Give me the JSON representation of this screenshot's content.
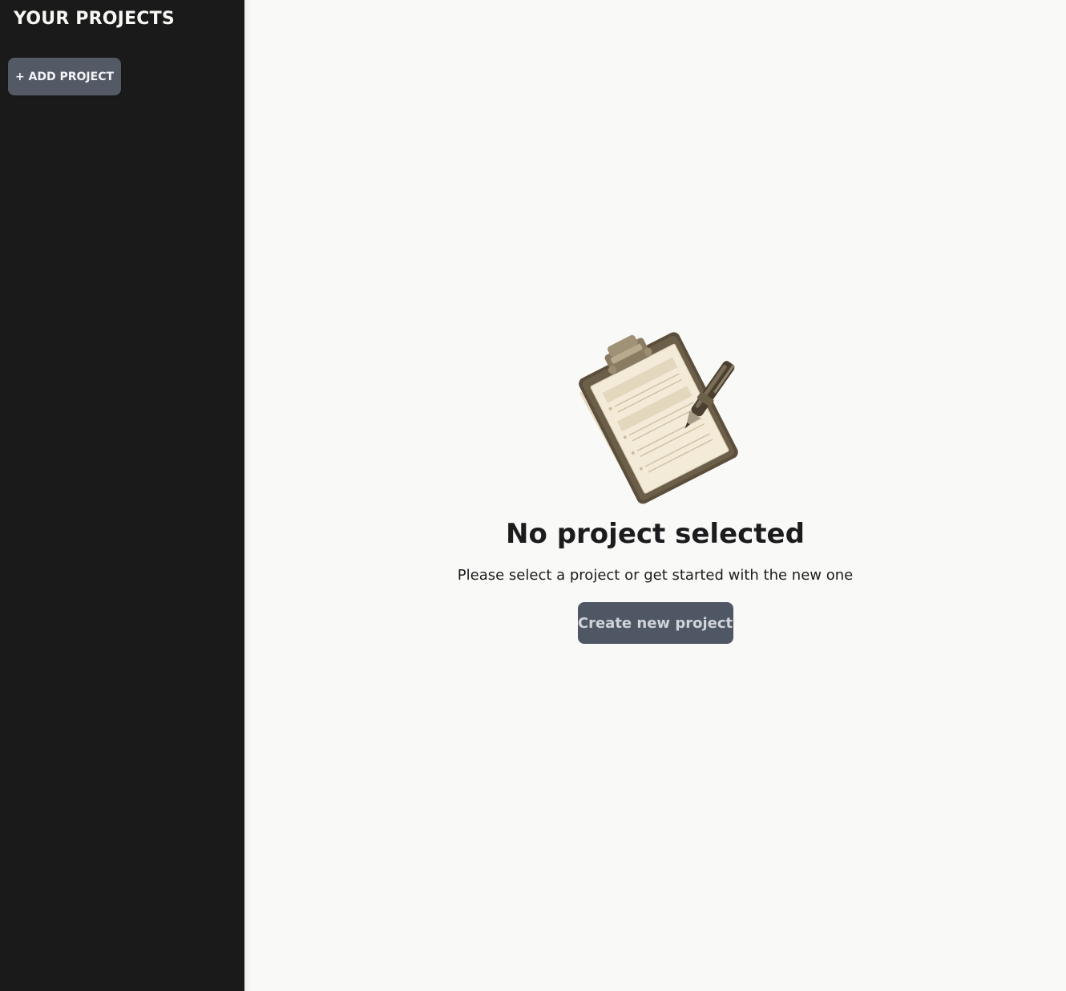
{
  "sidebar": {
    "title": "YOUR PROJECTS",
    "add_button_label": "+ ADD PROJECT"
  },
  "main": {
    "illustration_icon": "clipboard-with-pen-icon",
    "empty_title": "No project selected",
    "empty_subtitle": "Please select a project or get started with the new one",
    "create_button_label": "Create new project"
  },
  "colors": {
    "sidebar_bg": "#1a1a1b",
    "main_bg": "#f9f9f7",
    "button_bg": "#535a66",
    "text_dark": "#1c1c1e"
  }
}
